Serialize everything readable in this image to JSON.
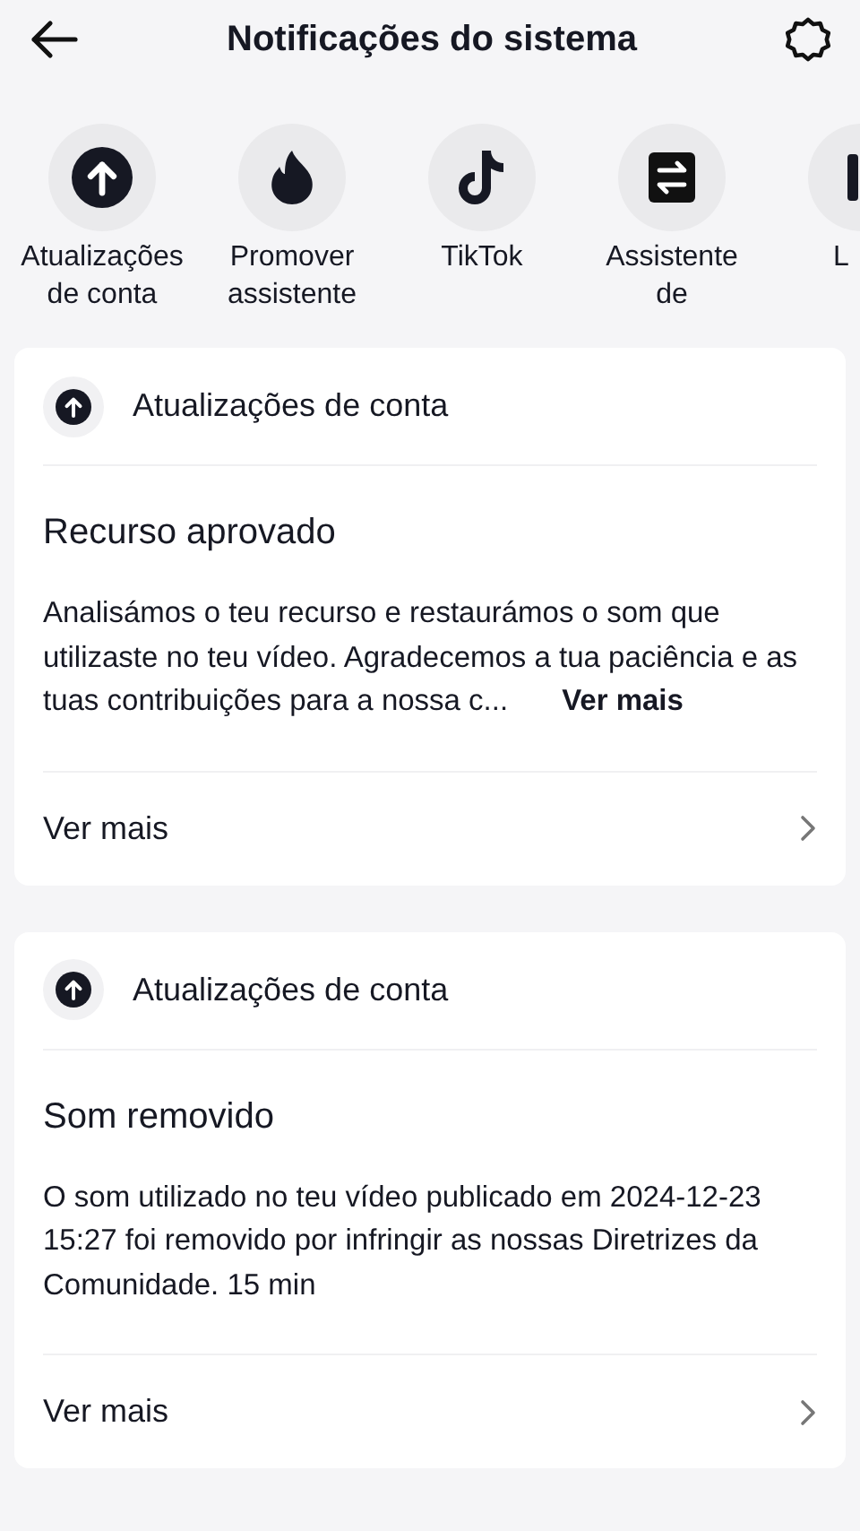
{
  "header": {
    "title": "Notificações do sistema"
  },
  "categories": [
    {
      "label": "Atualizações de conta",
      "kind": "upload"
    },
    {
      "label": "Promover assistente",
      "kind": "flame"
    },
    {
      "label": "TikTok",
      "kind": "note"
    },
    {
      "label": "Assistente de",
      "kind": "swap"
    },
    {
      "label": "L",
      "kind": "partial"
    }
  ],
  "notifications": [
    {
      "source": "Atualizações de conta",
      "title": "Recurso aprovado",
      "body": "Analisámos o teu recurso e restaurámos o som que utilizaste no teu vídeo. Agradecemos a tua paciência e as tuas contribuições para a nossa c...",
      "more": "Ver mais",
      "footer": "Ver mais"
    },
    {
      "source": "Atualizações de conta",
      "title": "Som removido",
      "body": "O som utilizado no teu vídeo publicado em 2024-12-23 15:27 foi removido por infringir as nossas Diretrizes da Comunidade. 15 min",
      "footer": "Ver mais"
    }
  ]
}
